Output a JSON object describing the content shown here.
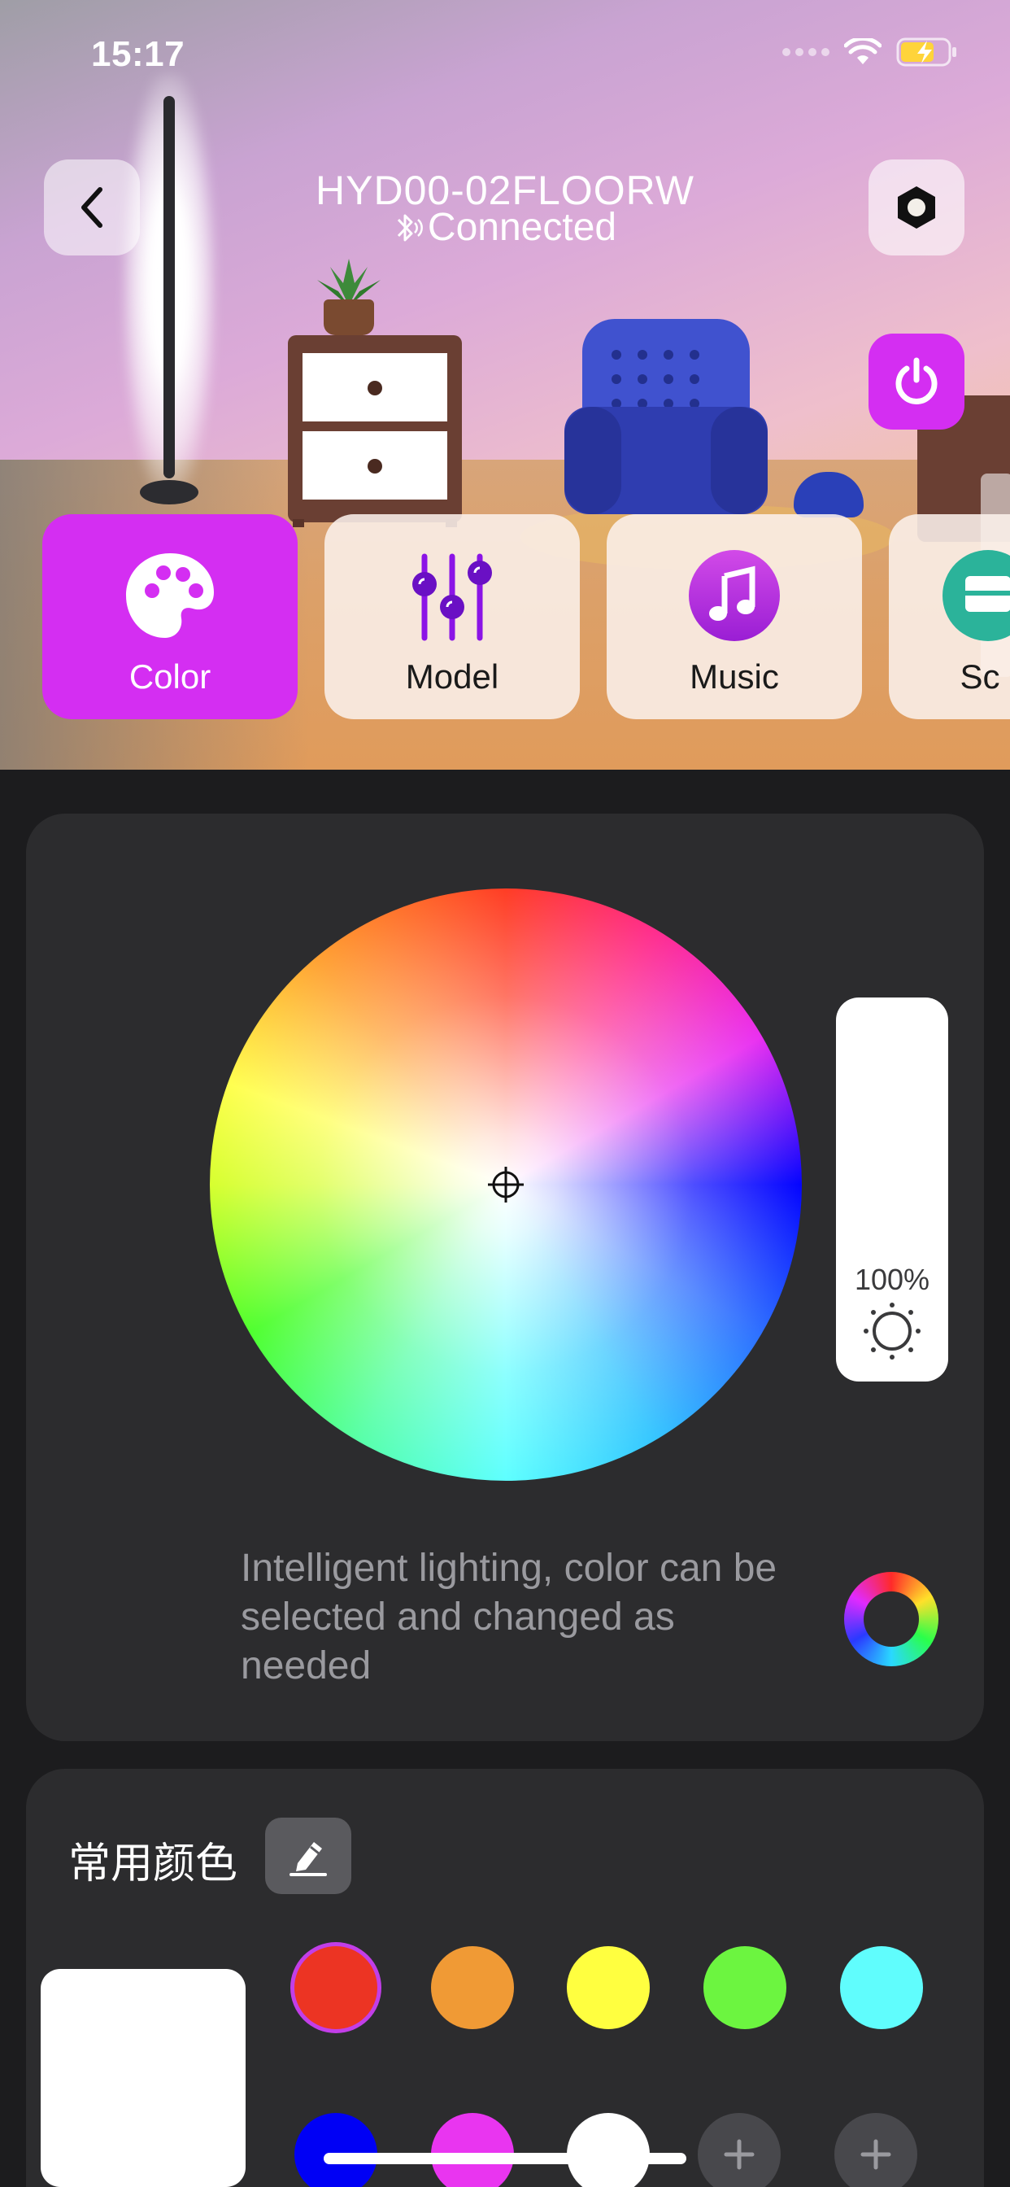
{
  "status_bar": {
    "time": "15:17"
  },
  "header": {
    "device_name": "HYD00-02FLOORW",
    "connection_status": "Connected"
  },
  "tabs": [
    {
      "label": "Color",
      "icon": "palette-icon",
      "active": true
    },
    {
      "label": "Model",
      "icon": "sliders-icon",
      "active": false
    },
    {
      "label": "Music",
      "icon": "music-note-icon",
      "active": false
    },
    {
      "label": "Sc",
      "icon": "scene-icon",
      "active": false
    }
  ],
  "color_panel": {
    "brightness_label": "100%",
    "brightness": 1.0,
    "description": "Intelligent lighting, color can be selected and changed as needed"
  },
  "favorites": {
    "title": "常用颜色",
    "preview_color": "#ffffff",
    "swatches": [
      "#ec3423",
      "#f09a35",
      "#ffff40",
      "#6cf540",
      "#60fdfd",
      "#0000f5",
      "#e935f0",
      "#ffffff"
    ],
    "selected_index": 0
  },
  "colors": {
    "accent": "#d42ef2",
    "card_bg": "#2c2c2e",
    "page_bg": "#1c1c1e"
  }
}
